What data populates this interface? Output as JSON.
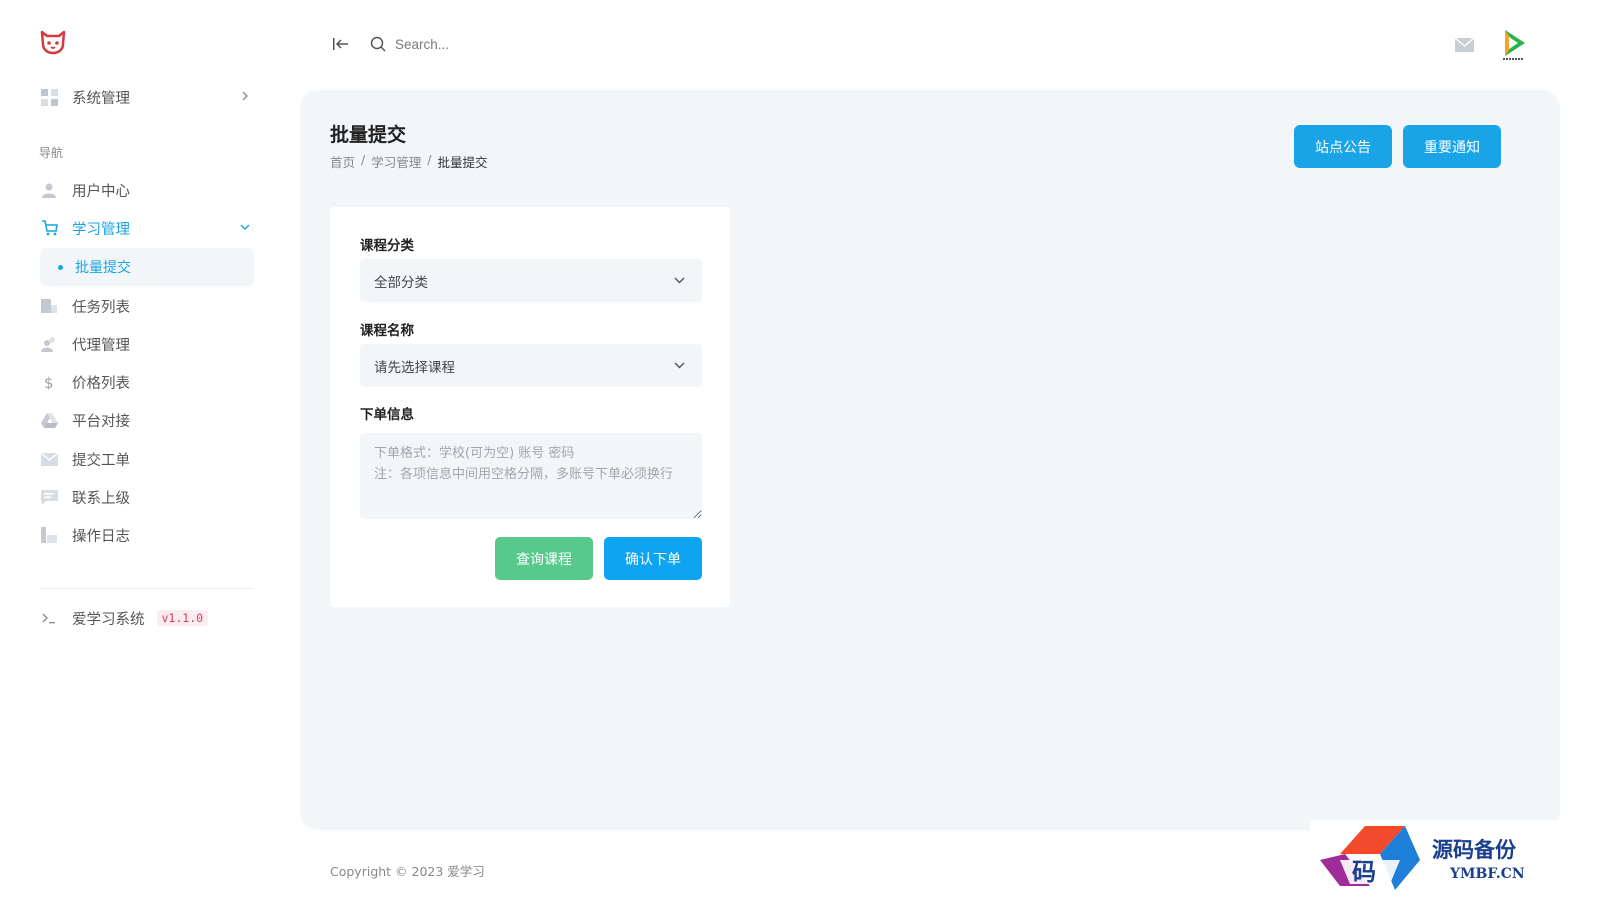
{
  "sidebar": {
    "system_menu": "系统管理",
    "nav_label": "导航",
    "items": [
      {
        "label": "用户中心",
        "icon": "user-icon"
      },
      {
        "label": "学习管理",
        "icon": "cart-icon"
      },
      {
        "label": "任务列表",
        "icon": "list-icon"
      },
      {
        "label": "代理管理",
        "icon": "users-icon"
      },
      {
        "label": "价格列表",
        "icon": "dollar-icon"
      },
      {
        "label": "平台对接",
        "icon": "drive-icon"
      },
      {
        "label": "提交工单",
        "icon": "mail-icon"
      },
      {
        "label": "联系上级",
        "icon": "chat-icon"
      },
      {
        "label": "操作日志",
        "icon": "chart-icon"
      }
    ],
    "sub_active": "批量提交",
    "footer_label": "爱学习系统",
    "version": "v1.1.0"
  },
  "topbar": {
    "search_placeholder": "Search..."
  },
  "page": {
    "title": "批量提交",
    "breadcrumb": [
      "首页",
      "学习管理",
      "批量提交"
    ],
    "notice_button": "站点公告",
    "important_button": "重要通知"
  },
  "form": {
    "category_label": "课程分类",
    "category_value": "全部分类",
    "course_label": "课程名称",
    "course_value": "请先选择课程",
    "order_label": "下单信息",
    "order_placeholder": "下单格式：学校(可为空) 账号 密码\n注：各项信息中间用空格分隔，多账号下单必须换行",
    "query_button": "查询课程",
    "confirm_button": "确认下单"
  },
  "footer": {
    "copyright": "Copyright © 2023 爱学习"
  },
  "watermark": {
    "title": "源码备份",
    "domain": "YMBF.CN",
    "glyph": "码"
  },
  "colors": {
    "accent": "#1aa4e8",
    "green": "#58c98c",
    "badge": "#d63a63"
  }
}
